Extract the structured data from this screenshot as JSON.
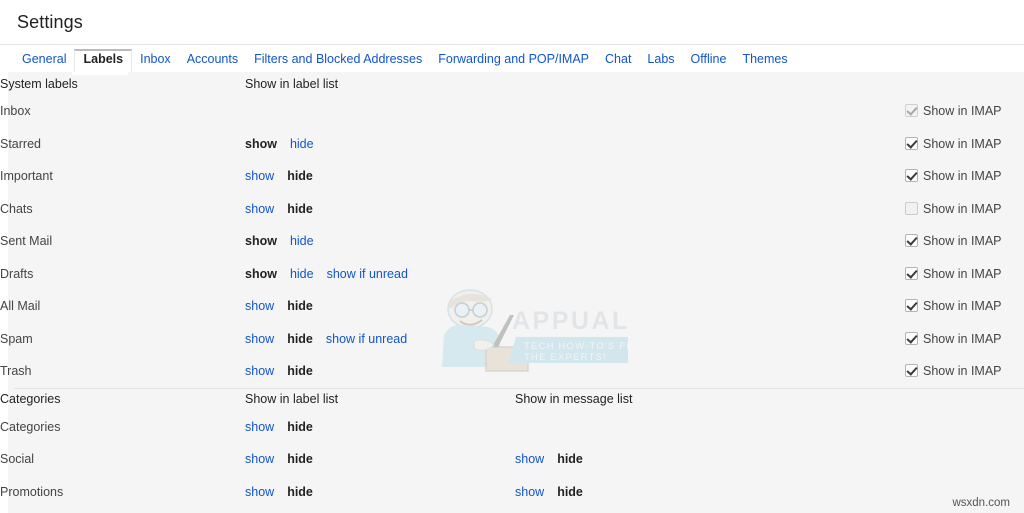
{
  "header": {
    "title": "Settings"
  },
  "tabs": [
    {
      "label": "General",
      "active": false
    },
    {
      "label": "Labels",
      "active": true
    },
    {
      "label": "Inbox",
      "active": false
    },
    {
      "label": "Accounts",
      "active": false
    },
    {
      "label": "Filters and Blocked Addresses",
      "active": false
    },
    {
      "label": "Forwarding and POP/IMAP",
      "active": false
    },
    {
      "label": "Chat",
      "active": false
    },
    {
      "label": "Labs",
      "active": false
    },
    {
      "label": "Offline",
      "active": false
    },
    {
      "label": "Themes",
      "active": false
    }
  ],
  "system_labels": {
    "heading": "System labels",
    "col_label_list": "Show in label list",
    "imap_text": "Show in IMAP",
    "rows": [
      {
        "name": "Inbox",
        "actions": [],
        "imap": {
          "checked": true,
          "disabled": true
        }
      },
      {
        "name": "Starred",
        "actions": [
          {
            "text": "show",
            "state": "current"
          },
          {
            "text": "hide",
            "state": "link"
          }
        ],
        "imap": {
          "checked": true,
          "disabled": false
        }
      },
      {
        "name": "Important",
        "actions": [
          {
            "text": "show",
            "state": "link"
          },
          {
            "text": "hide",
            "state": "current"
          }
        ],
        "imap": {
          "checked": true,
          "disabled": false
        }
      },
      {
        "name": "Chats",
        "actions": [
          {
            "text": "show",
            "state": "link"
          },
          {
            "text": "hide",
            "state": "current"
          }
        ],
        "imap": {
          "checked": false,
          "disabled": false
        }
      },
      {
        "name": "Sent Mail",
        "actions": [
          {
            "text": "show",
            "state": "current"
          },
          {
            "text": "hide",
            "state": "link"
          }
        ],
        "imap": {
          "checked": true,
          "disabled": false
        }
      },
      {
        "name": "Drafts",
        "actions": [
          {
            "text": "show",
            "state": "current"
          },
          {
            "text": "hide",
            "state": "link"
          },
          {
            "text": "show if unread",
            "state": "link"
          }
        ],
        "imap": {
          "checked": true,
          "disabled": false
        }
      },
      {
        "name": "All Mail",
        "actions": [
          {
            "text": "show",
            "state": "link"
          },
          {
            "text": "hide",
            "state": "current"
          }
        ],
        "imap": {
          "checked": true,
          "disabled": false
        }
      },
      {
        "name": "Spam",
        "actions": [
          {
            "text": "show",
            "state": "link"
          },
          {
            "text": "hide",
            "state": "current"
          },
          {
            "text": "show if unread",
            "state": "link"
          }
        ],
        "imap": {
          "checked": true,
          "disabled": false
        }
      },
      {
        "name": "Trash",
        "actions": [
          {
            "text": "show",
            "state": "link"
          },
          {
            "text": "hide",
            "state": "current"
          }
        ],
        "imap": {
          "checked": true,
          "disabled": false
        }
      }
    ]
  },
  "categories": {
    "heading": "Categories",
    "col_label_list": "Show in label list",
    "col_message_list": "Show in message list",
    "rows": [
      {
        "name": "Categories",
        "label_actions": [
          {
            "text": "show",
            "state": "link"
          },
          {
            "text": "hide",
            "state": "current"
          }
        ],
        "message_actions": []
      },
      {
        "name": "Social",
        "label_actions": [
          {
            "text": "show",
            "state": "link"
          },
          {
            "text": "hide",
            "state": "current"
          }
        ],
        "message_actions": [
          {
            "text": "show",
            "state": "link"
          },
          {
            "text": "hide",
            "state": "current"
          }
        ]
      },
      {
        "name": "Promotions",
        "label_actions": [
          {
            "text": "show",
            "state": "link"
          },
          {
            "text": "hide",
            "state": "current"
          }
        ],
        "message_actions": [
          {
            "text": "show",
            "state": "link"
          },
          {
            "text": "hide",
            "state": "current"
          }
        ]
      }
    ]
  },
  "watermarks": {
    "appuals_title": "APPUALS",
    "appuals_sub1": "TECH HOW-TO'S FROM",
    "appuals_sub2": "THE EXPERTS!",
    "corner": "wsxdn.com"
  },
  "colors": {
    "link": "#1155cc",
    "text": "#222222",
    "panel_bg": "#f5f5f5"
  }
}
